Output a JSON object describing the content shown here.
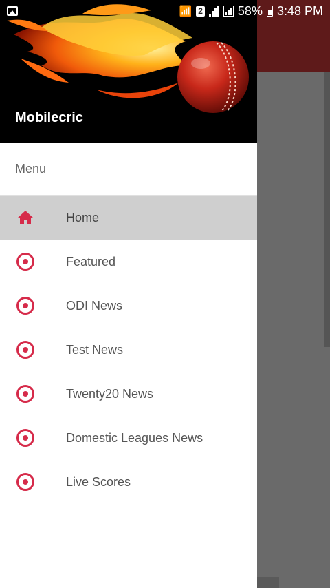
{
  "status_bar": {
    "sim_number": "2",
    "battery": "58%",
    "time": "3:48 PM"
  },
  "drawer": {
    "app_name": "Mobilecric",
    "menu_title": "Menu",
    "items": [
      {
        "label": "Home",
        "icon": "home-icon",
        "active": true
      },
      {
        "label": "Featured",
        "icon": "radio-circle-icon",
        "active": false
      },
      {
        "label": "ODI News",
        "icon": "radio-circle-icon",
        "active": false
      },
      {
        "label": "Test News",
        "icon": "radio-circle-icon",
        "active": false
      },
      {
        "label": "Twenty20 News",
        "icon": "radio-circle-icon",
        "active": false
      },
      {
        "label": "Domestic Leagues News",
        "icon": "radio-circle-icon",
        "active": false
      },
      {
        "label": "Live Scores",
        "icon": "radio-circle-icon",
        "active": false
      }
    ]
  },
  "colors": {
    "accent": "#d62b4a",
    "toolbar": "#5e1a1a",
    "active_item_bg": "#cfcfcf",
    "scrim": "#6a6a6a"
  }
}
